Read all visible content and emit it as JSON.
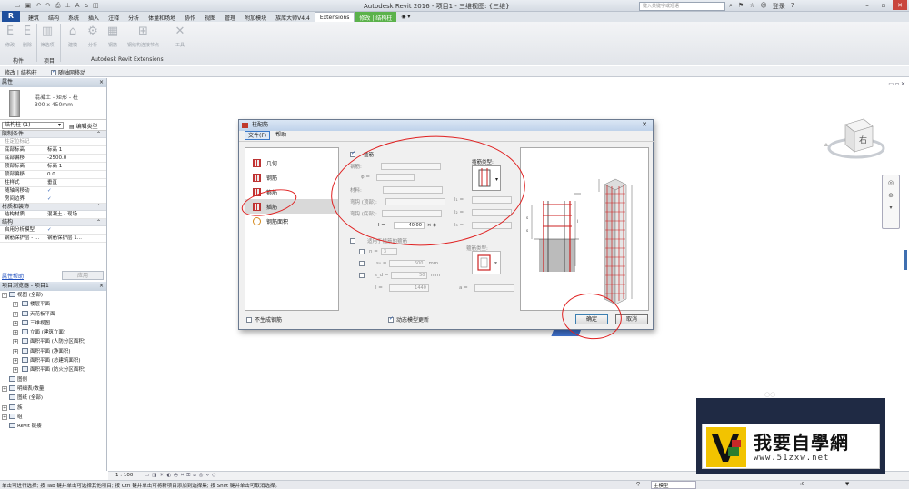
{
  "window": {
    "title": "Autodesk Revit 2016 -    项目1 - 三维视图: {三维}",
    "search_placeholder": "键入关键字或短语",
    "login": "登录",
    "qat_icons": [
      "open-icon",
      "save-icon",
      "undo-icon",
      "redo-icon",
      "print-icon",
      "measure-icon",
      "text-icon",
      "3d-icon",
      "section-icon"
    ]
  },
  "ribbon": {
    "app_button": "R",
    "tabs": [
      "建筑",
      "结构",
      "系统",
      "插入",
      "注释",
      "分析",
      "体量和场地",
      "协作",
      "视图",
      "管理",
      "附加模块",
      "族库大师V4.4",
      "Extensions",
      "修改 | 结构柱"
    ],
    "active_tab": "Extensions",
    "buttons": [
      {
        "label": "修改",
        "icon": "E"
      },
      {
        "label": "删除",
        "icon": "E"
      },
      {
        "label": "筛选项",
        "icon": "▥"
      },
      {
        "label": "建模",
        "icon": "⌂"
      },
      {
        "label": "分析",
        "icon": "⚙"
      },
      {
        "label": "钢筋",
        "icon": "▦"
      },
      {
        "label": "钢结构连接节点",
        "icon": "⊞"
      },
      {
        "label": "工具",
        "icon": "✕"
      }
    ],
    "panels": [
      "构件",
      "项目",
      "Autodesk Revit Extensions"
    ]
  },
  "options_bar": {
    "context": "修改 | 结构柱",
    "move_with_grids": "随轴网移动"
  },
  "properties": {
    "header": "属性",
    "type_family": "混凝土 - 矩形 - 柱",
    "type_size": "300 x 450mm",
    "instance": "结构柱 (1)",
    "edit_type": "编辑类型",
    "sections": [
      {
        "title": "限制条件",
        "rows": [
          {
            "k": "柱定位标记",
            "v": "",
            "ro": true
          },
          {
            "k": "底部标高",
            "v": "标高 1"
          },
          {
            "k": "底部偏移",
            "v": "-2500.0"
          },
          {
            "k": "顶部标高",
            "v": "标高 1"
          },
          {
            "k": "顶部偏移",
            "v": "0.0"
          },
          {
            "k": "柱样式",
            "v": "垂直"
          },
          {
            "k": "随轴网移动",
            "v": "✓"
          },
          {
            "k": "房间边界",
            "v": "✓"
          }
        ]
      },
      {
        "title": "材质和装饰",
        "rows": [
          {
            "k": "结构材质",
            "v": "混凝土 - 现场..."
          }
        ]
      },
      {
        "title": "结构",
        "rows": [
          {
            "k": "启用分析模型",
            "v": "✓"
          },
          {
            "k": "钢筋保护层 - ...",
            "v": "钢筋保护层 1..."
          }
        ]
      }
    ],
    "help": "属性帮助",
    "apply": "应用"
  },
  "browser": {
    "header": "项目浏览器 - 项目1",
    "nodes": [
      {
        "t": "视图 (全部)",
        "lvl": 0,
        "exp": "-"
      },
      {
        "t": "楼层平面",
        "lvl": 1,
        "exp": "+"
      },
      {
        "t": "天花板平面",
        "lvl": 1,
        "exp": "+"
      },
      {
        "t": "三维视图",
        "lvl": 1,
        "exp": "+"
      },
      {
        "t": "立面 (建筑立面)",
        "lvl": 1,
        "exp": "+"
      },
      {
        "t": "面积平面 (人防分区面积)",
        "lvl": 1,
        "exp": "+"
      },
      {
        "t": "面积平面 (净面积)",
        "lvl": 1,
        "exp": "+"
      },
      {
        "t": "面积平面 (总建筑面积)",
        "lvl": 1,
        "exp": "+"
      },
      {
        "t": "面积平面 (防火分区面积)",
        "lvl": 1,
        "exp": "+"
      },
      {
        "t": "图例",
        "lvl": 0,
        "exp": ""
      },
      {
        "t": "明细表/数量",
        "lvl": 0,
        "exp": "+"
      },
      {
        "t": "图纸 (全部)",
        "lvl": 0,
        "exp": ""
      },
      {
        "t": "族",
        "lvl": 0,
        "exp": "+"
      },
      {
        "t": "组",
        "lvl": 0,
        "exp": "+"
      },
      {
        "t": "Revit 链接",
        "lvl": 0,
        "exp": ""
      }
    ]
  },
  "view_control": {
    "scale": "1 : 100"
  },
  "statusbar": {
    "message": "单击可进行选择; 按 Tab 键并单击可选择其他项目; 按 Ctrl 键并单击可将新项目添加到选择集; 按 Shift 键并单击可取消选择。",
    "model": "主模型",
    "zero": ":0"
  },
  "dialog": {
    "title": "柱配筋",
    "menu": [
      "文件(F)",
      "帮助"
    ],
    "nav": [
      {
        "label": "几何",
        "selected": false
      },
      {
        "label": "钢筋",
        "selected": false
      },
      {
        "label": "箍筋",
        "selected": false
      },
      {
        "label": "插筋",
        "selected": true
      },
      {
        "label": "钢筋面积",
        "selected": false
      }
    ],
    "form": {
      "dowel_checkbox": "插筋",
      "rebar_label": "钢筋:",
      "phi_label": "ϕ =",
      "dowel_type_label": "插筋类型:",
      "material_label": "材料:",
      "hook_top_label": "弯钩 (顶部):",
      "hook_bottom_label": "弯钩 (底部):",
      "l_label": "l =",
      "l_value": "40.00",
      "l_unit": "× ϕ",
      "l1": "l₁ =",
      "l2": "l₂ =",
      "l3": "l₃ =",
      "stirrup_checkbox": "适用于插筋的箍筋",
      "stirrup_type_label": "箍筋类型:",
      "n_label": "n =",
      "n_value": "3",
      "s_o_label": "s₀ =",
      "s_o_value": "600",
      "s_d_label": "s_d =",
      "s_d_value": "50",
      "mm": "mm",
      "l_bottom_label": "l =",
      "l_bottom_value": "1440",
      "a_label": "a ="
    },
    "no_rebar": "不生成钢筋",
    "dynamic_update": "动态模型更新",
    "ok": "确定",
    "cancel": "取消"
  },
  "viewcube": {
    "face": "右"
  },
  "watermark": {
    "text": "我要自學網",
    "url": "www.51zxw.net"
  }
}
